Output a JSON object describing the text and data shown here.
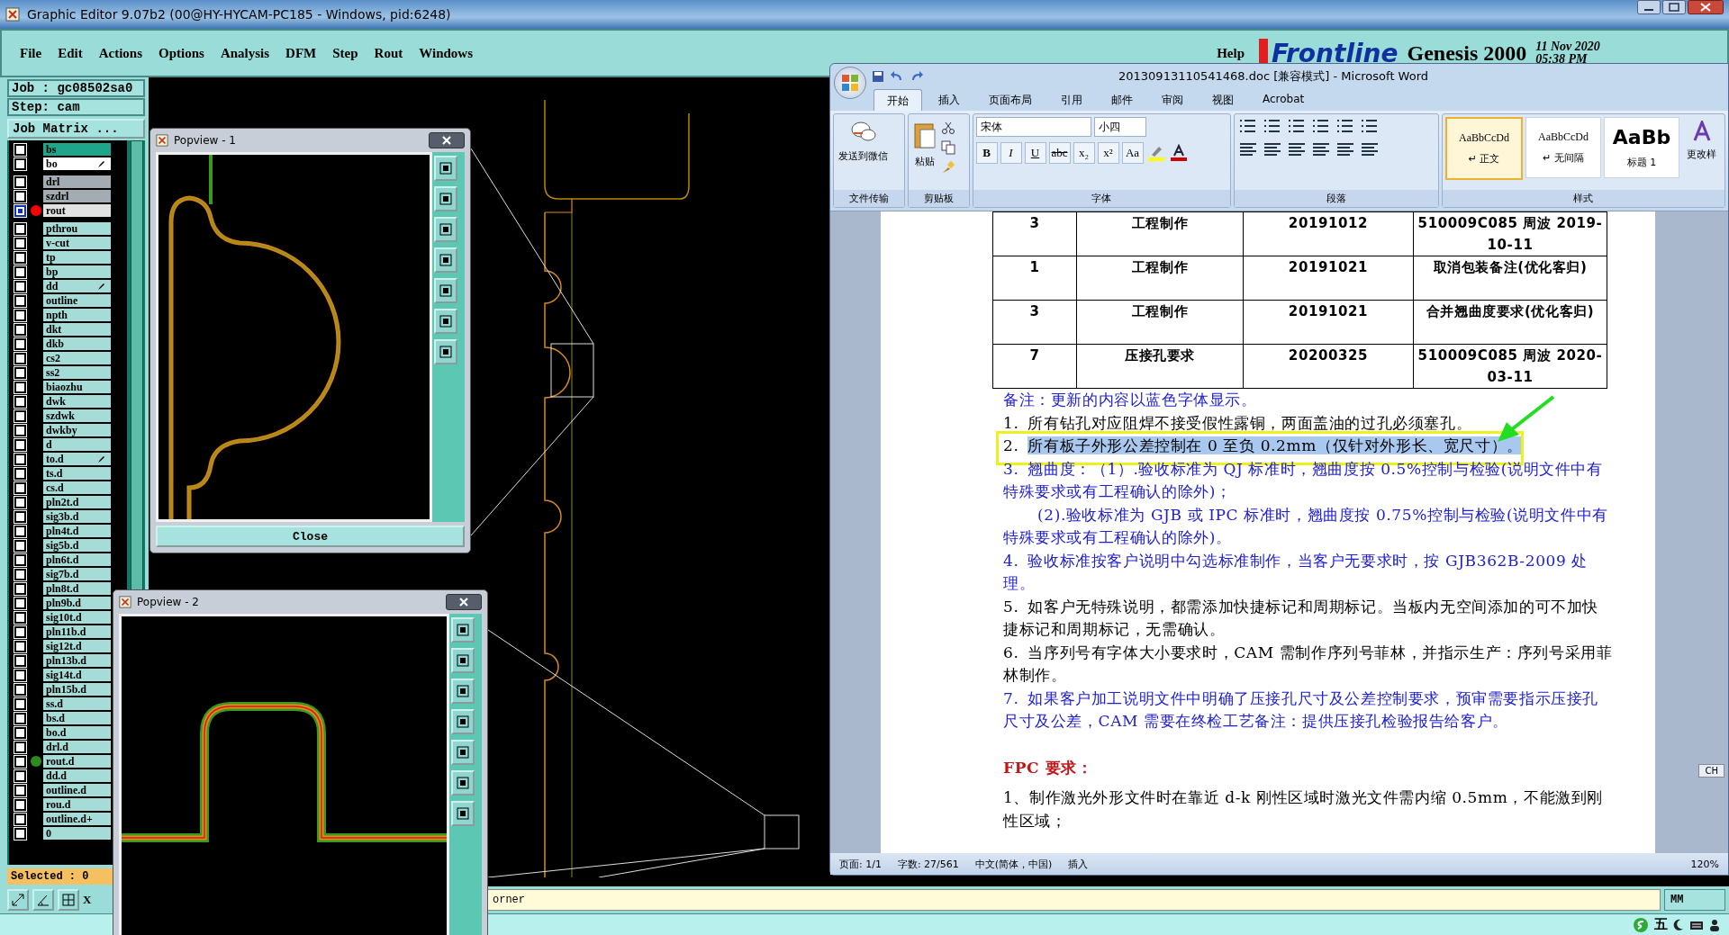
{
  "window": {
    "title": "Graphic Editor 9.07b2 (00@HY-HYCAM-PC185 - Windows, pid:6248)"
  },
  "menu": [
    "File",
    "Edit",
    "Actions",
    "Options",
    "Analysis",
    "DFM",
    "Step",
    "Rout",
    "Windows"
  ],
  "help": "Help",
  "brand": {
    "logo": "Frontline",
    "product": "Genesis 2000",
    "date": "11 Nov 2020",
    "time": "05:38 PM"
  },
  "job": {
    "job": "Job : gc08502sa0",
    "step": "Step: cam",
    "matrix_button": "Job Matrix ..."
  },
  "layers": [
    {
      "name": "bs",
      "kind": "board",
      "selected": false,
      "affected": false,
      "marked": false
    },
    {
      "name": "bo",
      "kind": "board",
      "selected": false,
      "affected": true,
      "marked": true
    },
    {
      "name": "drl",
      "kind": "drill",
      "selected": false,
      "affected": false,
      "marked": false
    },
    {
      "name": "szdrl",
      "kind": "drill",
      "selected": false,
      "affected": false,
      "marked": false
    },
    {
      "name": "rout",
      "kind": "drill",
      "selected": true,
      "affected": true,
      "marked": false,
      "color": "#ff0000"
    },
    {
      "name": "pthrou",
      "kind": "misc",
      "selected": false,
      "affected": false,
      "marked": false
    },
    {
      "name": "v-cut",
      "kind": "misc",
      "selected": false,
      "affected": false,
      "marked": false
    },
    {
      "name": "tp",
      "kind": "misc",
      "selected": false,
      "affected": false,
      "marked": false
    },
    {
      "name": "bp",
      "kind": "misc",
      "selected": false,
      "affected": false,
      "marked": false
    },
    {
      "name": "dd",
      "kind": "misc",
      "selected": false,
      "affected": false,
      "marked": true
    },
    {
      "name": "outline",
      "kind": "misc",
      "selected": false,
      "affected": false,
      "marked": false
    },
    {
      "name": "npth",
      "kind": "misc",
      "selected": false,
      "affected": false,
      "marked": false
    },
    {
      "name": "dkt",
      "kind": "misc",
      "selected": false,
      "affected": false,
      "marked": false
    },
    {
      "name": "dkb",
      "kind": "misc",
      "selected": false,
      "affected": false,
      "marked": false
    },
    {
      "name": "cs2",
      "kind": "misc",
      "selected": false,
      "affected": false,
      "marked": false
    },
    {
      "name": "ss2",
      "kind": "misc",
      "selected": false,
      "affected": false,
      "marked": false
    },
    {
      "name": "biaozhu",
      "kind": "misc",
      "selected": false,
      "affected": false,
      "marked": false
    },
    {
      "name": "dwk",
      "kind": "misc",
      "selected": false,
      "affected": false,
      "marked": false
    },
    {
      "name": "szdwk",
      "kind": "misc",
      "selected": false,
      "affected": false,
      "marked": false
    },
    {
      "name": "dwkby",
      "kind": "misc",
      "selected": false,
      "affected": false,
      "marked": false
    },
    {
      "name": "d",
      "kind": "misc",
      "selected": false,
      "affected": false,
      "marked": false
    },
    {
      "name": "to.d",
      "kind": "misc",
      "selected": false,
      "affected": false,
      "marked": true
    },
    {
      "name": "ts.d",
      "kind": "misc",
      "selected": false,
      "affected": false,
      "marked": false
    },
    {
      "name": "cs.d",
      "kind": "misc",
      "selected": false,
      "affected": false,
      "marked": false
    },
    {
      "name": "pln2t.d",
      "kind": "misc",
      "selected": false,
      "affected": false,
      "marked": false
    },
    {
      "name": "sig3b.d",
      "kind": "misc",
      "selected": false,
      "affected": false,
      "marked": false
    },
    {
      "name": "pln4t.d",
      "kind": "misc",
      "selected": false,
      "affected": false,
      "marked": false
    },
    {
      "name": "sig5b.d",
      "kind": "misc",
      "selected": false,
      "affected": false,
      "marked": false
    },
    {
      "name": "pln6t.d",
      "kind": "misc",
      "selected": false,
      "affected": false,
      "marked": false
    },
    {
      "name": "sig7b.d",
      "kind": "misc",
      "selected": false,
      "affected": false,
      "marked": false
    },
    {
      "name": "pln8t.d",
      "kind": "misc",
      "selected": false,
      "affected": false,
      "marked": false
    },
    {
      "name": "pln9b.d",
      "kind": "misc",
      "selected": false,
      "affected": false,
      "marked": false
    },
    {
      "name": "sig10t.d",
      "kind": "misc",
      "selected": false,
      "affected": false,
      "marked": false
    },
    {
      "name": "pln11b.d",
      "kind": "misc",
      "selected": false,
      "affected": false,
      "marked": false
    },
    {
      "name": "sig12t.d",
      "kind": "misc",
      "selected": false,
      "affected": false,
      "marked": false
    },
    {
      "name": "pln13b.d",
      "kind": "misc",
      "selected": false,
      "affected": false,
      "marked": false
    },
    {
      "name": "sig14t.d",
      "kind": "misc",
      "selected": false,
      "affected": false,
      "marked": false
    },
    {
      "name": "pln15b.d",
      "kind": "misc",
      "selected": false,
      "affected": false,
      "marked": false
    },
    {
      "name": "ss.d",
      "kind": "misc",
      "selected": false,
      "affected": false,
      "marked": false
    },
    {
      "name": "bs.d",
      "kind": "misc",
      "selected": false,
      "affected": false,
      "marked": false
    },
    {
      "name": "bo.d",
      "kind": "misc",
      "selected": false,
      "affected": false,
      "marked": false
    },
    {
      "name": "drl.d",
      "kind": "misc",
      "selected": false,
      "affected": false,
      "marked": false
    },
    {
      "name": "rout.d",
      "kind": "misc",
      "selected": false,
      "affected": false,
      "marked": false,
      "color": "#2e8b1e"
    },
    {
      "name": "dd.d",
      "kind": "misc",
      "selected": false,
      "affected": false,
      "marked": false
    },
    {
      "name": "outline.d",
      "kind": "misc",
      "selected": false,
      "affected": false,
      "marked": false
    },
    {
      "name": "rou.d",
      "kind": "misc",
      "selected": false,
      "affected": false,
      "marked": false
    },
    {
      "name": "outline.d+",
      "kind": "misc",
      "selected": false,
      "affected": false,
      "marked": false
    },
    {
      "name": "0",
      "kind": "misc",
      "selected": false,
      "affected": false,
      "marked": false
    }
  ],
  "selected_count": "Selected : 0",
  "coord_label": "X",
  "status_text": "orner",
  "units": "MM",
  "popviews": [
    {
      "title": "Popview - 1",
      "close_button": "Close"
    },
    {
      "title": "Popview - 2"
    }
  ],
  "word": {
    "title": "20130913110541468.doc [兼容模式] - Microsoft Word",
    "tabs": [
      {
        "label": "开始",
        "selected": true
      },
      {
        "label": "插入",
        "selected": false
      },
      {
        "label": "页面布局",
        "selected": false
      },
      {
        "label": "引用",
        "selected": false
      },
      {
        "label": "邮件",
        "selected": false
      },
      {
        "label": "审阅",
        "selected": false
      },
      {
        "label": "视图",
        "selected": false
      },
      {
        "label": "Acrobat",
        "selected": false
      }
    ],
    "send_button": "发送到微信",
    "paste_button": "粘贴",
    "font_name": "宋体",
    "font_size": "小四",
    "font_buttons": [
      "B",
      "I",
      "U",
      "abc",
      "x₂",
      "x²",
      "Aa"
    ],
    "styles": [
      {
        "sample": "AaBbCcDd",
        "label": "↵ 正文",
        "selected": true
      },
      {
        "sample": "AaBbCcDd",
        "label": "↵ 无间隔",
        "selected": false
      },
      {
        "sample": "AaBb",
        "label": "标题 1",
        "selected": false
      }
    ],
    "change_styles": "更改样",
    "groups": [
      "文件传输",
      "剪贴板",
      "字体",
      "段落",
      "样式"
    ],
    "table": {
      "rows": [
        [
          "3",
          "工程制作",
          "20191012",
          "510009C085 周波 2019-10-11"
        ],
        [
          "1",
          "工程制作",
          "20191021",
          "取消包装备注(优化客归)"
        ],
        [
          "3",
          "工程制作",
          "20191021",
          "合并翘曲度要求(优化客归)"
        ],
        [
          "7",
          "压接孔要求",
          "20200325",
          "510009C085 周波 2020-03-11"
        ]
      ]
    },
    "paragraphs": [
      {
        "kind": "updated",
        "text": "备注：更新的内容以蓝色字体显示。",
        "highlighted": false
      },
      {
        "kind": "normal",
        "number": "1.",
        "text": "所有钻孔对应阻焊不接受假性露铜，两面盖油的过孔必须塞孔。",
        "highlighted": false
      },
      {
        "kind": "normal",
        "number": "2.",
        "text": "所有板子外形公差控制在 0 至负 0.2mm（仅针对外形长、宽尺寸）。",
        "highlighted": true
      },
      {
        "kind": "updated",
        "number": "3.",
        "text": "翘曲度：（1）.验收标准为 QJ 标准时，翘曲度按 0.5%控制与检验(说明文件中有特殊要求或有工程确认的除外)；",
        "highlighted": false
      },
      {
        "kind": "indented",
        "text": "(2).验收标准为 GJB 或 IPC 标准时，翘曲度按 0.75%控制与检验(说明文件中有特殊要求或有工程确认的除外)。",
        "highlighted": false
      },
      {
        "kind": "updated",
        "number": "4.",
        "text": "验收标准按客户说明中勾选标准制作，当客户无要求时，按 GJB362B-2009 处理。",
        "highlighted": false
      },
      {
        "kind": "normal",
        "number": "5.",
        "text": "如客户无特殊说明，都需添加快捷标记和周期标记。当板内无空间添加的可不加快捷标记和周期标记，无需确认。",
        "highlighted": false
      },
      {
        "kind": "normal",
        "number": "6.",
        "text": "当序列号有字体大小要求时，CAM 需制作序列号菲林，并指示生产：序列号采用菲林制作。",
        "highlighted": false
      },
      {
        "kind": "updated",
        "number": "7.",
        "text": "如果客户加工说明文件中明确了压接孔尺寸及公差控制要求，预审需要指示压接孔尺寸及公差，CAM 需要在终检工艺备注：提供压接孔检验报告给客户。",
        "highlighted": false
      },
      {
        "kind": "heading",
        "text": "FPC 要求：",
        "highlighted": false
      },
      {
        "kind": "normal",
        "text": "1、制作激光外形文件时在靠近 d-k 刚性区域时激光文件需内缩 0.5mm，不能激到刚性区域；",
        "highlighted": false
      }
    ],
    "status": [
      "页面: 1/1",
      "字数: 27/561",
      "中文(简体，中国)",
      "插入"
    ],
    "zoom": "120%"
  },
  "ime": "CH",
  "tray": "五"
}
